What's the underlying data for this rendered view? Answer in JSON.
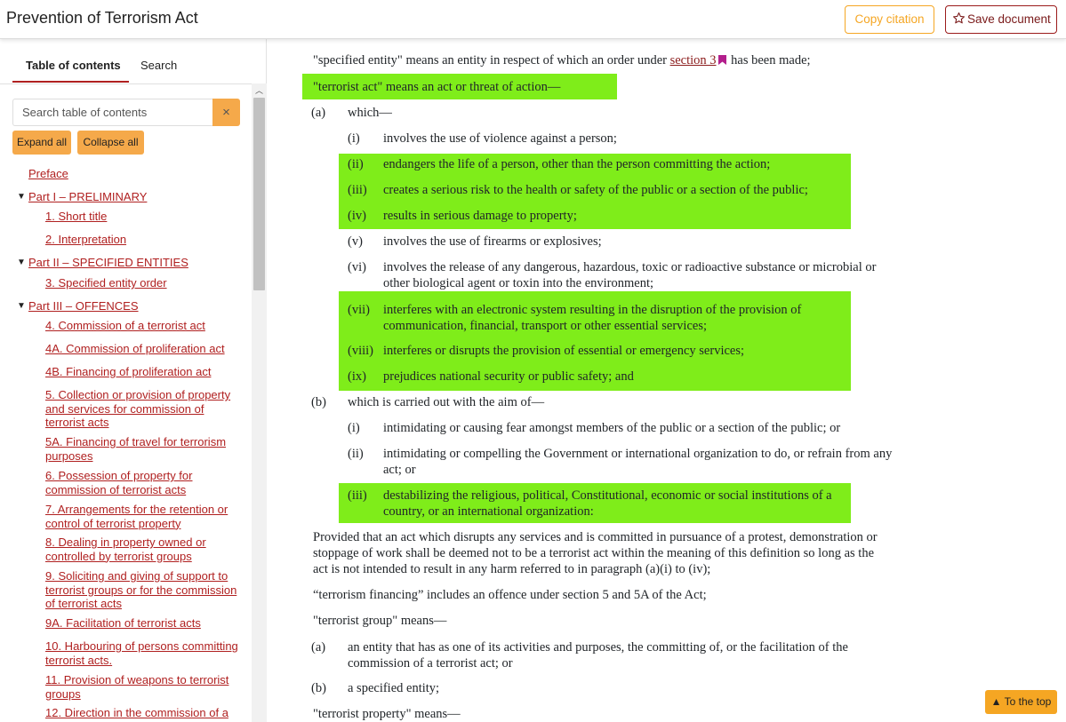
{
  "header": {
    "title": "Prevention of Terrorism Act",
    "copy_label": "Copy citation",
    "save_label": "Save document"
  },
  "sidebar": {
    "tabs": [
      "Table of contents",
      "Search"
    ],
    "search_placeholder": "Search table of contents",
    "clear_symbol": "×",
    "expand_label": "Expand all",
    "collapse_label": "Collapse all",
    "toc": [
      {
        "label": "Preface"
      },
      {
        "label": "Part I – PRELIMINARY"
      },
      {
        "label": "1. Short title"
      },
      {
        "label": "2. Interpretation"
      },
      {
        "label": "Part II – SPECIFIED ENTITIES"
      },
      {
        "label": "3. Specified entity order"
      },
      {
        "label": "Part III – OFFENCES"
      },
      {
        "label": "4. Commission of a terrorist act"
      },
      {
        "label": "4A. Commission of proliferation act"
      },
      {
        "label": "4B. Financing of proliferation act"
      },
      {
        "label": "5. Collection or provision of property and services for commission of terrorist acts"
      },
      {
        "label": "5A. Financing of travel for terrorism purposes"
      },
      {
        "label": "6. Possession of property for commission of terrorist acts"
      },
      {
        "label": "7. Arrangements for the retention or control of terrorist property"
      },
      {
        "label": "8. Dealing in property owned or controlled by terrorist groups"
      },
      {
        "label": "9. Soliciting and giving of support to terrorist groups or for the commission of terrorist acts"
      },
      {
        "label": "9A. Facilitation of terrorist acts"
      },
      {
        "label": "10. Harbouring of persons committing terrorist acts."
      },
      {
        "label": "11. Provision of weapons to terrorist groups"
      },
      {
        "label": "12. Direction in the commission of a"
      }
    ]
  },
  "content": {
    "specified_entity": {
      "pre": "\"specified entity\" means an entity in respect of which an order under ",
      "link": "section 3",
      "post": " has been made;"
    },
    "terrorist_act_heading": "\"terrorist act\" means an act or threat of action—",
    "para_a_label": "(a)",
    "para_a_text": "which—",
    "a_items": [
      {
        "label": "(i)",
        "text": "involves the use of violence against a person;"
      },
      {
        "label": "(ii)",
        "text": "endangers the life of a person, other than the person committing the action;"
      },
      {
        "label": "(iii)",
        "text": "creates a serious risk to the health or safety of the public or a section of the public;"
      },
      {
        "label": "(iv)",
        "text": "results in serious damage to property;"
      },
      {
        "label": "(v)",
        "text": "involves the use of firearms or explosives;"
      },
      {
        "label": "(vi)",
        "text": "involves the release of any dangerous, hazardous, toxic or radioactive substance or microbial or other biological agent or toxin into the environment;"
      },
      {
        "label": "(vii)",
        "text": "interferes with an electronic system resulting in the disruption of the provision of communication, financial, transport or other essential services;"
      },
      {
        "label": "(viii)",
        "text": "interferes or disrupts the provision of essential or emergency services;"
      },
      {
        "label": "(ix)",
        "text": "prejudices national security or public safety; and"
      }
    ],
    "para_b_label": "(b)",
    "para_b_text": "which is carried out with the aim of—",
    "b_items": [
      {
        "label": "(i)",
        "text": "intimidating or causing fear amongst members of the public or a section of the public; or"
      },
      {
        "label": "(ii)",
        "text": "intimidating or compelling the Government or international organization to do, or refrain from any act; or"
      },
      {
        "label": "(iii)",
        "text": "destabilizing the religious, political, Constitutional, economic or social institutions of a country, or an international organization:"
      }
    ],
    "proviso": "Provided that an act which disrupts any services and is committed in pursuance of a protest, demonstration or stoppage of work shall be deemed not to be a terrorist act within the meaning of this definition so long as the act is not intended to result in any harm referred to in paragraph (a)(i) to (iv);",
    "terrorism_financing": "“terrorism financing” includes an offence under section 5 and 5A of the Act;",
    "terrorist_group_heading": "\"terrorist group\" means—",
    "group_items": [
      {
        "label": "(a)",
        "text": "an entity that has as one of its activities and purposes, the committing of, or the facilitation of the commission of a terrorist act; or"
      },
      {
        "label": "(b)",
        "text": "a specified entity;"
      }
    ],
    "terrorist_property_heading": "\"terrorist property\" means—"
  },
  "to_top_label": "▲ To the top",
  "colors": {
    "highlight": "#7fed1a",
    "accent_orange": "#f5a623",
    "link_red": "#b02020",
    "bookmark": "#b31e8c"
  }
}
